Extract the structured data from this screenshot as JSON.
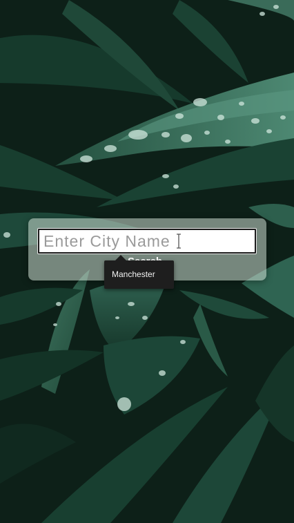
{
  "search": {
    "placeholder": "Enter City Name",
    "value": "",
    "button_label": "Search"
  },
  "autocomplete": {
    "options": [
      "Manchester"
    ]
  },
  "colors": {
    "card_background": "#cddcd2",
    "suggestion_background": "#1e1e1e",
    "leaf_dark": "#0c1f17",
    "leaf_mid": "#2b5a45"
  }
}
